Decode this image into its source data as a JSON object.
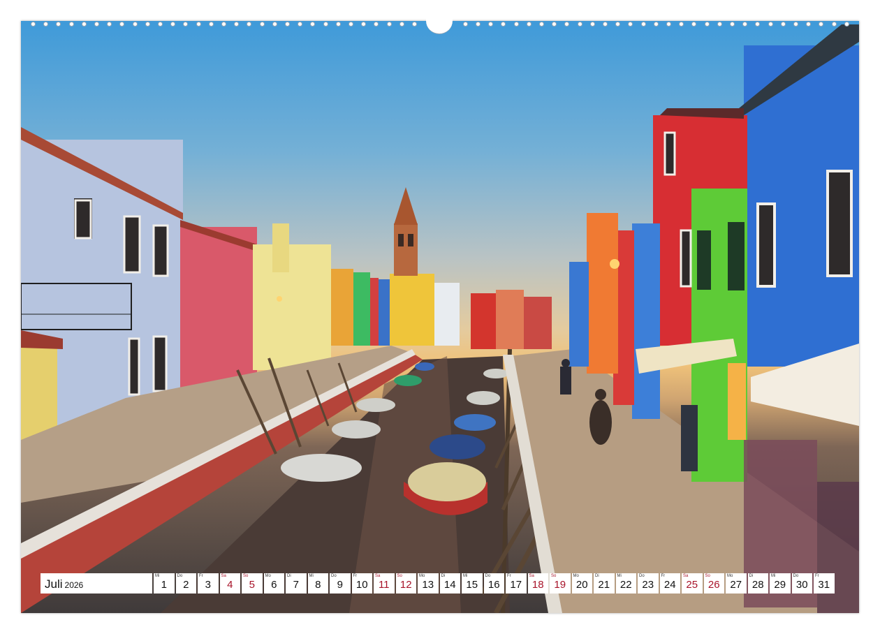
{
  "calendar": {
    "month": "Juli",
    "year": "2026",
    "days": [
      {
        "wd": "Mi",
        "d": "1",
        "weekend": false
      },
      {
        "wd": "Do",
        "d": "2",
        "weekend": false
      },
      {
        "wd": "Fr",
        "d": "3",
        "weekend": false
      },
      {
        "wd": "Sa",
        "d": "4",
        "weekend": true
      },
      {
        "wd": "So",
        "d": "5",
        "weekend": true
      },
      {
        "wd": "Mo",
        "d": "6",
        "weekend": false
      },
      {
        "wd": "Di",
        "d": "7",
        "weekend": false
      },
      {
        "wd": "Mi",
        "d": "8",
        "weekend": false
      },
      {
        "wd": "Do",
        "d": "9",
        "weekend": false
      },
      {
        "wd": "Fr",
        "d": "10",
        "weekend": false
      },
      {
        "wd": "Sa",
        "d": "11",
        "weekend": true
      },
      {
        "wd": "So",
        "d": "12",
        "weekend": true
      },
      {
        "wd": "Mo",
        "d": "13",
        "weekend": false
      },
      {
        "wd": "Di",
        "d": "14",
        "weekend": false
      },
      {
        "wd": "Mi",
        "d": "15",
        "weekend": false
      },
      {
        "wd": "Do",
        "d": "16",
        "weekend": false
      },
      {
        "wd": "Fr",
        "d": "17",
        "weekend": false
      },
      {
        "wd": "Sa",
        "d": "18",
        "weekend": true
      },
      {
        "wd": "So",
        "d": "19",
        "weekend": true
      },
      {
        "wd": "Mo",
        "d": "20",
        "weekend": false
      },
      {
        "wd": "Di",
        "d": "21",
        "weekend": false
      },
      {
        "wd": "Mi",
        "d": "22",
        "weekend": false
      },
      {
        "wd": "Do",
        "d": "23",
        "weekend": false
      },
      {
        "wd": "Fr",
        "d": "24",
        "weekend": false
      },
      {
        "wd": "Sa",
        "d": "25",
        "weekend": true
      },
      {
        "wd": "So",
        "d": "26",
        "weekend": true
      },
      {
        "wd": "Mo",
        "d": "27",
        "weekend": false
      },
      {
        "wd": "Di",
        "d": "28",
        "weekend": false
      },
      {
        "wd": "Mi",
        "d": "29",
        "weekend": false
      },
      {
        "wd": "Do",
        "d": "30",
        "weekend": false
      },
      {
        "wd": "Fr",
        "d": "31",
        "weekend": false
      }
    ]
  },
  "colors": {
    "weekend": "#a8142a",
    "canal": "#4a3b36",
    "sky_top": "#3f9ad9",
    "sky_horizon": "#f0c27a"
  },
  "icons": [
    "spiral-binding-icon"
  ]
}
